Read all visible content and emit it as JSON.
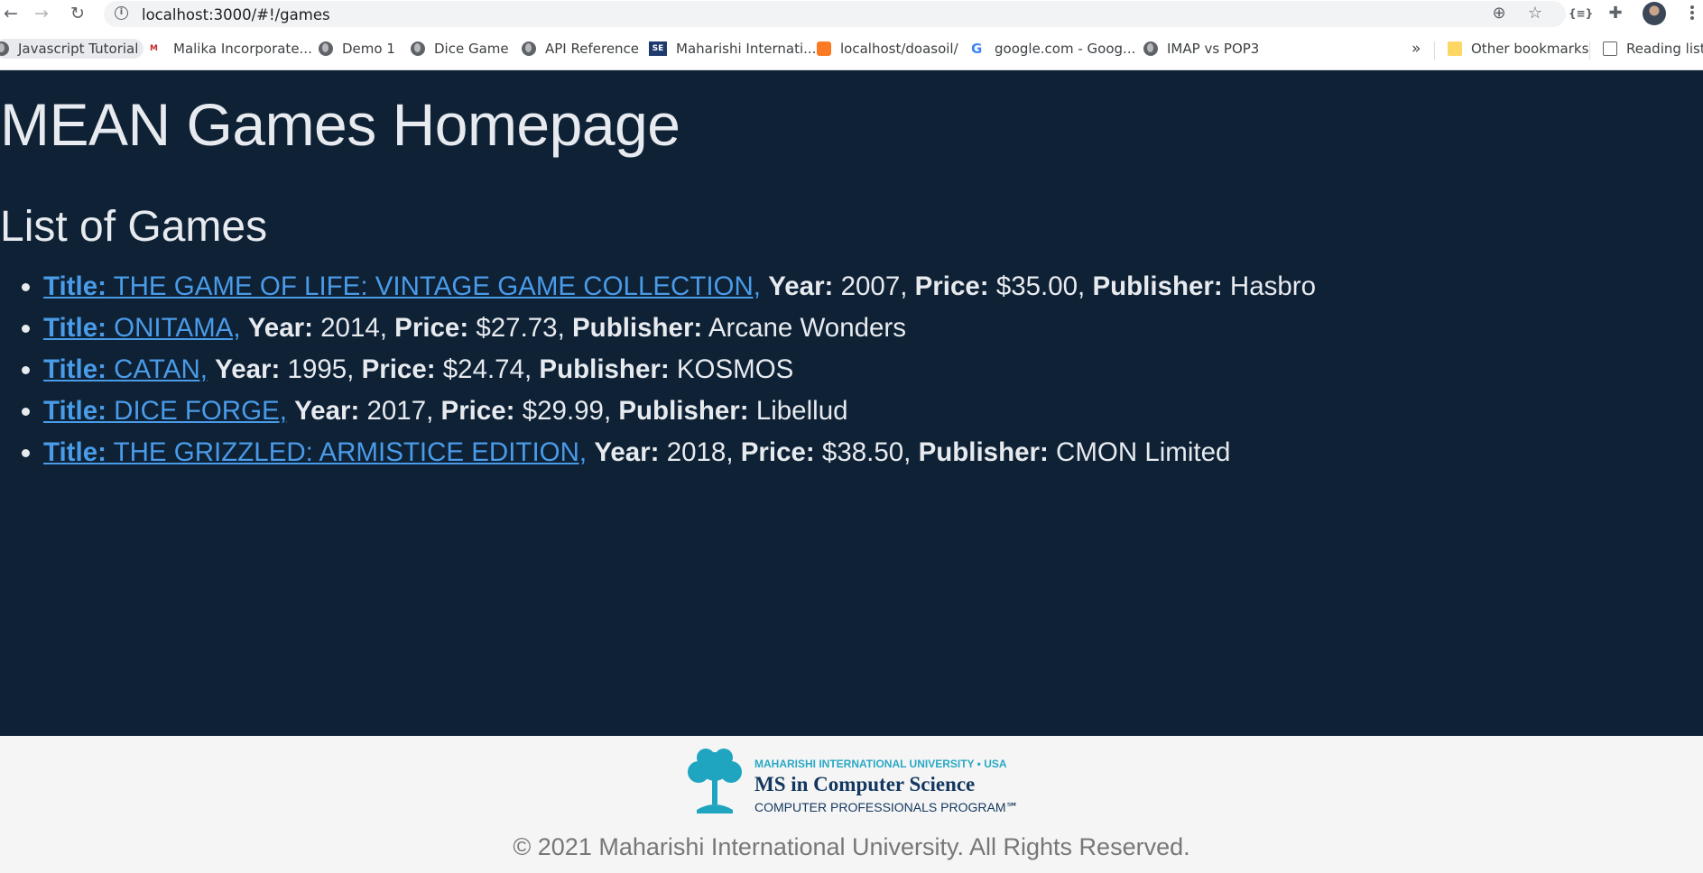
{
  "browser": {
    "url": "localhost:3000/#!/games",
    "bookmarks": [
      {
        "label": "Javascript Tutorial",
        "icon": "globe-icon"
      },
      {
        "label": "Malika Incorporate...",
        "icon": "malika-favicon-icon"
      },
      {
        "label": "Demo 1",
        "icon": "globe-icon"
      },
      {
        "label": "Dice Game",
        "icon": "globe-icon"
      },
      {
        "label": "API Reference",
        "icon": "globe-icon"
      },
      {
        "label": "Maharishi Internati...",
        "icon": "se-favicon-icon"
      },
      {
        "label": "localhost/doasoil/",
        "icon": "xampp-favicon-icon"
      },
      {
        "label": "google.com - Goog...",
        "icon": "google-icon"
      },
      {
        "label": "IMAP vs POP3",
        "icon": "globe-icon"
      }
    ],
    "overflow_label": "»",
    "other_bookmarks": "Other bookmarks",
    "reading_list": "Reading list"
  },
  "page": {
    "title": "MEAN Games Homepage",
    "list_heading": "List of Games",
    "labels": {
      "title": "Title:",
      "year": "Year:",
      "price": "Price:",
      "publisher": "Publisher:"
    },
    "games": [
      {
        "title": "THE GAME OF LIFE: VINTAGE GAME COLLECTION,",
        "year": "2007,",
        "price": "$35.00,",
        "publisher": "Hasbro"
      },
      {
        "title": "ONITAMA,",
        "year": "2014,",
        "price": "$27.73,",
        "publisher": "Arcane Wonders"
      },
      {
        "title": "CATAN,",
        "year": "1995,",
        "price": "$24.74,",
        "publisher": "KOSMOS"
      },
      {
        "title": "DICE FORGE,",
        "year": "2017,",
        "price": "$29.99,",
        "publisher": "Libellud"
      },
      {
        "title": "THE GRIZZLED: ARMISTICE EDITION,",
        "year": "2018,",
        "price": "$38.50,",
        "publisher": "CMON Limited"
      }
    ]
  },
  "footer": {
    "logo_top": "MAHARISHI INTERNATIONAL UNIVERSITY • USA",
    "logo_main": "MS in Computer Science",
    "logo_sub": "COMPUTER PROFESSIONALS PROGRAM℠",
    "copyright": "© 2021 Maharishi International University. All Rights Reserved."
  },
  "colors": {
    "page_bg": "#0e2135",
    "link": "#4a9be8",
    "footer_bg": "#f5f5f5"
  }
}
